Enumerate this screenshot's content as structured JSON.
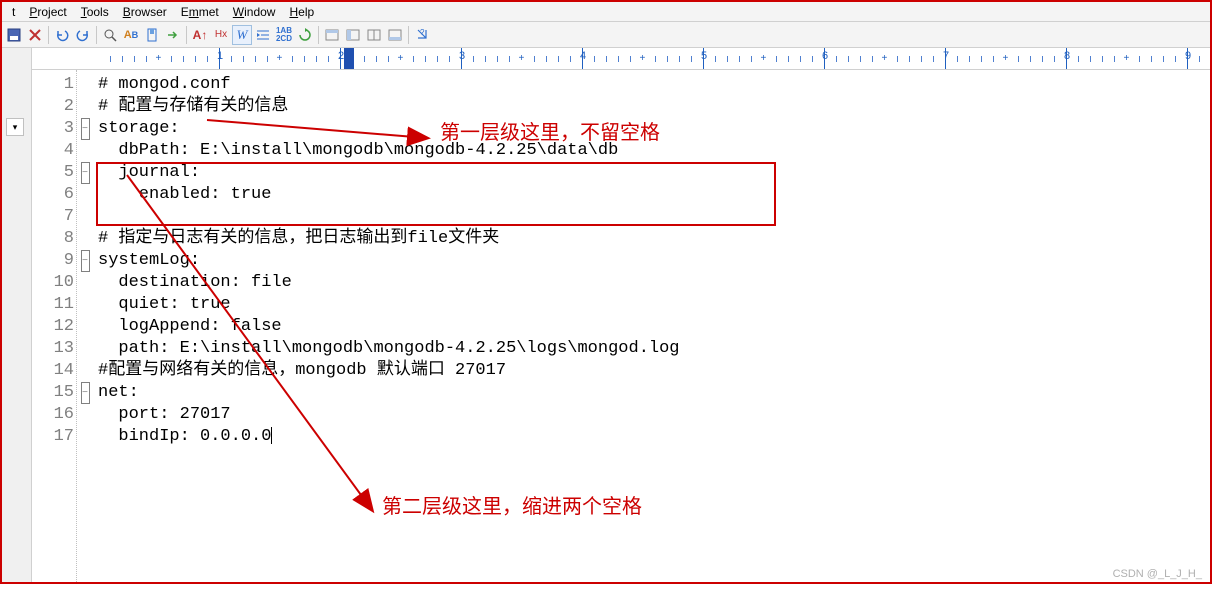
{
  "menu": {
    "items": [
      "Project",
      "Tools",
      "Browser",
      "Emmet",
      "Window",
      "Help"
    ],
    "left_snippet": "t"
  },
  "ruler": {
    "marks": [
      "1",
      "2",
      "3",
      "4",
      "5",
      "6",
      "7",
      "8",
      "9"
    ]
  },
  "code": {
    "lines": [
      {
        "n": "1",
        "fold": "",
        "text": "# mongod.conf"
      },
      {
        "n": "2",
        "fold": "",
        "text": "# 配置与存储有关的信息"
      },
      {
        "n": "3",
        "fold": "-",
        "text": "storage:"
      },
      {
        "n": "4",
        "fold": "",
        "text": "  dbPath: E:\\install\\mongodb\\mongodb-4.2.25\\data\\db"
      },
      {
        "n": "5",
        "fold": "-",
        "text": "  journal:"
      },
      {
        "n": "6",
        "fold": "",
        "text": "    enabled: true"
      },
      {
        "n": "7",
        "fold": "",
        "text": ""
      },
      {
        "n": "8",
        "fold": "",
        "text": "# 指定与日志有关的信息，把日志输出到file文件夹"
      },
      {
        "n": "9",
        "fold": "-",
        "text": "systemLog:"
      },
      {
        "n": "10",
        "fold": "",
        "text": "  destination: file"
      },
      {
        "n": "11",
        "fold": "",
        "text": "  quiet: true"
      },
      {
        "n": "12",
        "fold": "",
        "text": "  logAppend: false"
      },
      {
        "n": "13",
        "fold": "",
        "text": "  path: E:\\install\\mongodb\\mongodb-4.2.25\\logs\\mongod.log"
      },
      {
        "n": "14",
        "fold": "",
        "text": "#配置与网络有关的信息，mongodb 默认端口 27017"
      },
      {
        "n": "15",
        "fold": "-",
        "text": "net:"
      },
      {
        "n": "16",
        "fold": "",
        "text": "  port: 27017"
      },
      {
        "n": "17",
        "fold": "",
        "text": "  bindIp: 0.0.0.0"
      }
    ]
  },
  "annotations": {
    "a1": "第一层级这里，不留空格",
    "a2": "第二层级这里，缩进两个空格"
  },
  "watermark": "CSDN @_L_J_H_",
  "colors": {
    "accent": "#cc0000",
    "ruler": "#2060c0"
  }
}
